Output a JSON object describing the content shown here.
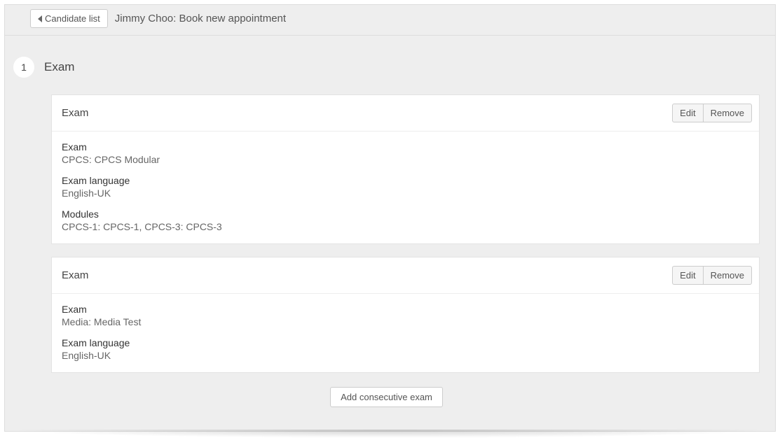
{
  "header": {
    "back_label": "Candidate list",
    "title": "Jimmy Choo: Book new appointment"
  },
  "step": {
    "number": "1",
    "title": "Exam"
  },
  "buttons": {
    "edit": "Edit",
    "remove": "Remove",
    "add_consecutive": "Add consecutive exam"
  },
  "labels": {
    "card_title": "Exam",
    "exam": "Exam",
    "exam_language": "Exam language",
    "modules": "Modules"
  },
  "exams": [
    {
      "exam_value": "CPCS: CPCS Modular",
      "language_value": "English-UK",
      "modules_value": "CPCS-1: CPCS-1, CPCS-3: CPCS-3"
    },
    {
      "exam_value": "Media: Media Test",
      "language_value": "English-UK",
      "modules_value": null
    }
  ]
}
